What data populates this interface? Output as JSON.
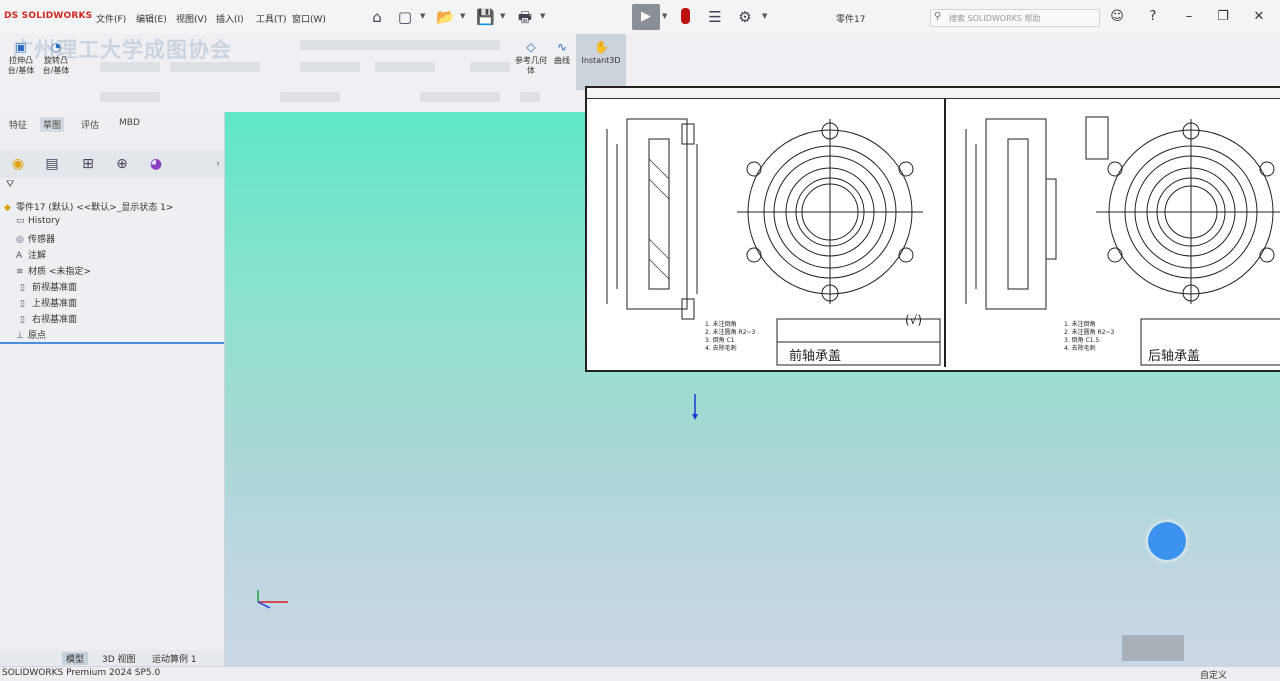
{
  "app": {
    "logo": "DS SOLIDWORKS",
    "doc_title": "零件17"
  },
  "menu": [
    "文件(F)",
    "编辑(E)",
    "视图(V)",
    "插入(I)",
    "工具(T)",
    "窗口(W)"
  ],
  "toolbar_icons": [
    "home-icon",
    "new-icon",
    "open-icon",
    "save-icon",
    "print-icon",
    "select-icon",
    "traffic-light-icon",
    "options-list-icon",
    "settings-icon"
  ],
  "search": {
    "placeholder": "搜索 SOLIDWORKS 帮助"
  },
  "watermark": "广州理工大学成图协会",
  "commands": {
    "extrude_boss": "拉伸凸台/基体",
    "revolve_boss": "旋转凸台/基体",
    "ref_geometry": "参考几何体",
    "curves": "曲线",
    "instant3d": "Instant3D"
  },
  "panel_tabs": [
    "特征",
    "草图",
    "评估",
    "MBD"
  ],
  "tree": {
    "root": "零件17 (默认) <<默认>_显示状态 1>",
    "items": [
      "History",
      "传感器",
      "注解",
      "材质 <未指定>",
      "前视基准面",
      "上视基准面",
      "右视基准面",
      "原点"
    ]
  },
  "bottom_tabs": [
    "模型",
    "3D 视图",
    "运动算例 1"
  ],
  "status": {
    "left": "SOLIDWORKS Premium 2024 SP5.0",
    "right": "自定义"
  },
  "drawing": {
    "left": {
      "title": "前轴承盖",
      "notes": [
        "1. 未注倒角",
        "2. 未注圆角 R2~3",
        "3. 倒角 C1",
        "4. 去除毛刺"
      ],
      "symbol": "(√)"
    },
    "right": {
      "title": "后轴承盖",
      "notes": [
        "1. 未注倒角",
        "2. 未注圆角 R2~3",
        "3. 倒角 C1.5",
        "4. 去除毛刺"
      ]
    }
  },
  "colors": {
    "viewport_top": "#5fe6c6",
    "viewport_bottom": "#cbd6e6",
    "accent": "#3b93ef",
    "logo_red": "#d0281e"
  }
}
